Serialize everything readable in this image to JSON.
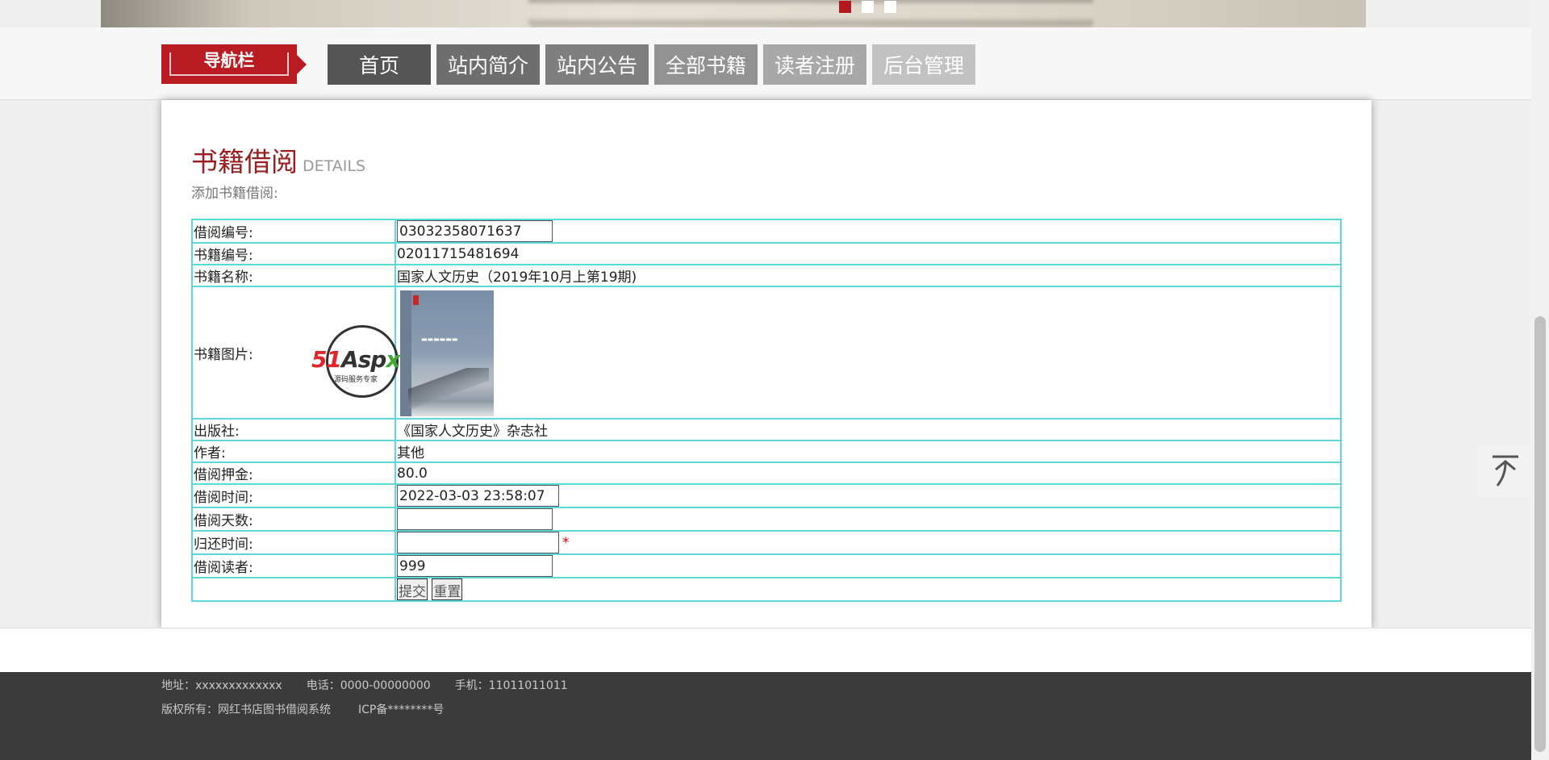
{
  "nav": {
    "label": "导航栏",
    "items": [
      "首页",
      "站内简介",
      "站内公告",
      "全部书籍",
      "读者注册",
      "后台管理"
    ]
  },
  "section": {
    "title": "书籍借阅",
    "subtitle": "DETAILS",
    "description": "添加书籍借阅:"
  },
  "form": {
    "borrow_no_label": "借阅编号:",
    "borrow_no_value": "03032358071637",
    "book_no_label": "书籍编号:",
    "book_no_value": "02011715481694",
    "book_name_label": "书籍名称:",
    "book_name_value": "国家人文历史（2019年10月上第19期)",
    "book_image_label": "书籍图片:",
    "publisher_label": "出版社:",
    "publisher_value": "《国家人文历史》杂志社",
    "author_label": "作者:",
    "author_value": "其他",
    "deposit_label": "借阅押金:",
    "deposit_value": "80.0",
    "borrow_time_label": "借阅时间:",
    "borrow_time_value": "2022-03-03 23:58:07",
    "borrow_days_label": "借阅天数:",
    "borrow_days_value": "",
    "return_time_label": "归还时间:",
    "return_time_value": "",
    "required_mark": "*",
    "reader_label": "借阅读者:",
    "reader_value": "999",
    "submit_label": "提交",
    "reset_label": "重置"
  },
  "watermark": {
    "brand_a": "51",
    "brand_b": "Asp",
    "brand_c": "x",
    "caption": "源码服务专家"
  },
  "footer": {
    "address": "地址：xxxxxxxxxxxxx",
    "phone": "电话：0000-00000000",
    "mobile": "手机：11011011011",
    "copyright": "版权所有：网红书店图书借阅系统",
    "icp": "ICP备********号"
  },
  "colors": {
    "brand_red": "#b81c22",
    "table_border": "#5dd8d8",
    "footer_bg": "#3b3b3b"
  },
  "icons": [
    "back-to-top-icon"
  ]
}
